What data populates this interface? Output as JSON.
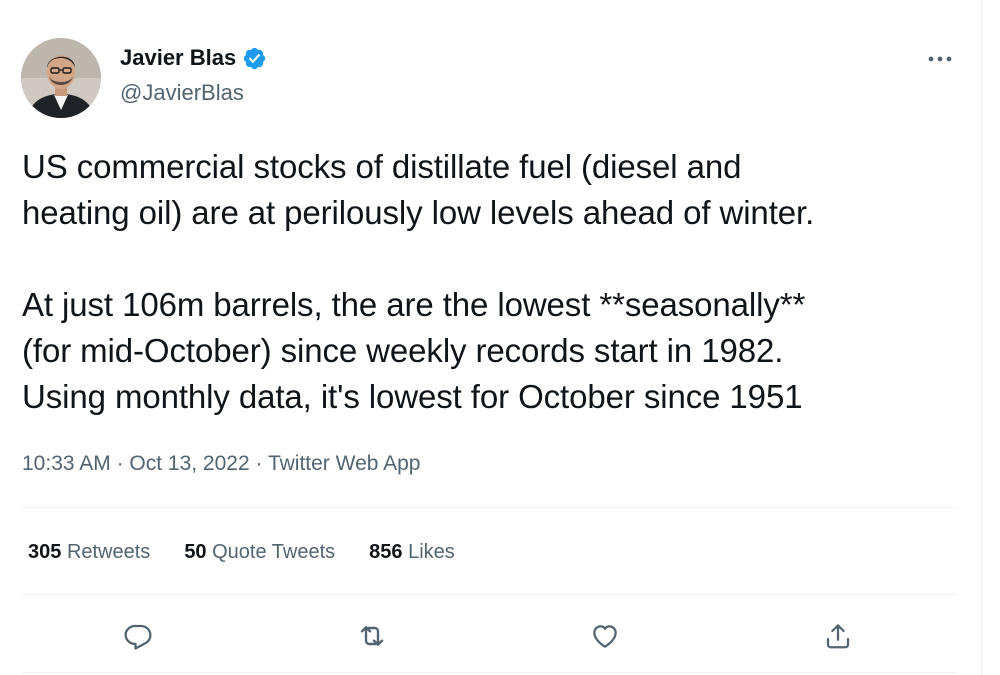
{
  "author": {
    "display_name": "Javier Blas",
    "handle": "@JavierBlas",
    "verified": true
  },
  "tweet": {
    "text": "US commercial stocks of distillate fuel (diesel and\nheating oil) are at perilously low levels ahead of winter.\n\nAt just 106m barrels, the are the lowest **seasonally**\n(for mid-October) since weekly records start in 1982.\nUsing monthly data, it's lowest for October since 1951",
    "time": "10:33 AM",
    "date": "Oct 13, 2022",
    "source": "Twitter Web App",
    "separator": "·"
  },
  "stats": {
    "retweets_count": "305",
    "retweets_label": "Retweets",
    "quote_tweets_count": "50",
    "quote_tweets_label": "Quote Tweets",
    "likes_count": "856",
    "likes_label": "Likes"
  },
  "icons": {
    "verified": "verified-badge-icon",
    "more": "more-options-icon",
    "reply": "reply-icon",
    "retweet": "retweet-icon",
    "like": "like-icon",
    "share": "share-icon"
  },
  "colors": {
    "verified_blue": "#1d9bf0",
    "primary_text": "#0f1419",
    "secondary_text": "#536471",
    "divider": "#eff3f4"
  }
}
